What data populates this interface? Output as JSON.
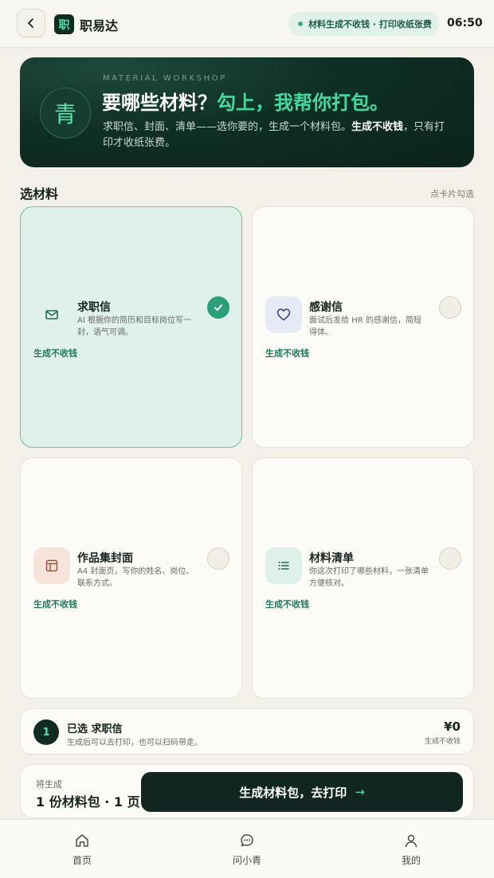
{
  "header": {
    "app_logo_char": "职",
    "app_name": "职易达",
    "status_text": "材料生成不收钱 · 打印收纸张费",
    "time": "06:50"
  },
  "hero": {
    "badge_char": "青",
    "eyebrow": "MATERIAL WORKSHOP",
    "title_main": "要哪些材料？",
    "title_highlight": "勾上，我帮你打包。",
    "desc_before": "求职信、封面、清单——选你要的，生成一个材料包。",
    "desc_bold": "生成不收钱",
    "desc_after": "，只有打印才收纸张费。"
  },
  "section": {
    "title": "选材料",
    "hint": "点卡片勾选"
  },
  "materials": [
    {
      "title": "求职信",
      "desc": "AI 根据你的简历和目标岗位写一封，语气可调。",
      "note": "生成不收钱",
      "selected": true,
      "icon": "mail-icon",
      "icon_bg": "#dff1ea",
      "icon_color": "#1f6b50"
    },
    {
      "title": "感谢信",
      "desc": "面试后发给 HR 的感谢信，简短得体。",
      "note": "生成不收钱",
      "selected": false,
      "icon": "heart-icon",
      "icon_bg": "#e6e9f6",
      "icon_color": "#3b4a7a"
    },
    {
      "title": "作品集封面",
      "desc": "A4 封面页，写你的姓名、岗位、联系方式。",
      "note": "生成不收钱",
      "selected": false,
      "icon": "layout-icon",
      "icon_bg": "#f6e4db",
      "icon_color": "#a4533a"
    },
    {
      "title": "材料清单",
      "desc": "你这次打印了哪些材料，一张清单方便核对。",
      "note": "生成不收钱",
      "selected": false,
      "icon": "list-icon",
      "icon_bg": "#ddf0ea",
      "icon_color": "#1f6b50"
    }
  ],
  "summary": {
    "count": "1",
    "title": "已选 求职信",
    "subtitle": "生成后可以去打印，也可以扫码带走。",
    "price": "¥0",
    "price_note": "生成不收钱"
  },
  "action": {
    "label": "将生成",
    "value": "1 份材料包 · 1 页",
    "button": "生成材料包，去打印",
    "arrow": "→"
  },
  "nav": [
    {
      "label": "首页",
      "icon": "home-icon"
    },
    {
      "label": "问小青",
      "icon": "chat-icon"
    },
    {
      "label": "我的",
      "icon": "user-icon"
    }
  ]
}
